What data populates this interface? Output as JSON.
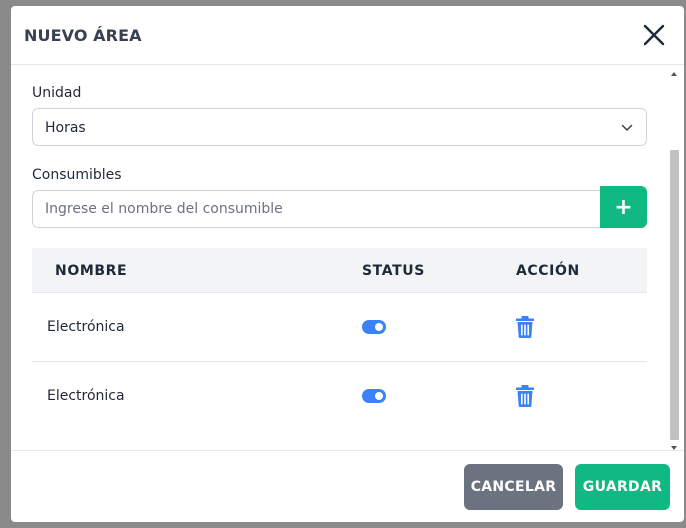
{
  "modal": {
    "title": "NUEVO ÁREA",
    "close_icon": "close-icon"
  },
  "form": {
    "unidad_label": "Unidad",
    "unidad_value": "Horas",
    "consumibles_label": "Consumibles",
    "consumible_placeholder": "Ingrese el nombre del consumible",
    "add_label": "+"
  },
  "table": {
    "headers": [
      "NOMBRE",
      "STATUS",
      "ACCIÓN"
    ],
    "rows": [
      {
        "name": "Electrónica",
        "status": true,
        "action_icon": "trash-icon"
      },
      {
        "name": "Electrónica",
        "status": true,
        "action_icon": "trash-icon"
      }
    ]
  },
  "footer": {
    "cancel_label": "CANCELAR",
    "save_label": "GUARDAR"
  },
  "colors": {
    "primary_green": "#10b981",
    "toggle_blue": "#3b82f6",
    "cancel_gray": "#6b7280"
  }
}
